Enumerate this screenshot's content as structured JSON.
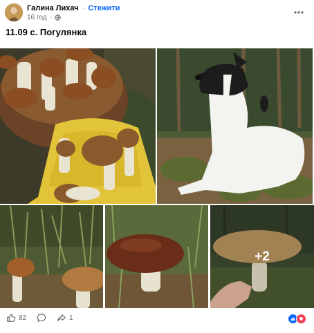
{
  "post": {
    "author": "Галина Лихач",
    "separator": "·",
    "follow_label": "Стежити",
    "time": "16 год",
    "text": "11.09 с. Погулянка"
  },
  "photos": {
    "overflow_label": "+2",
    "items": [
      {
        "name": "mushroom-basket-photo"
      },
      {
        "name": "dog-photo"
      },
      {
        "name": "mushrooms-in-grass-photo"
      },
      {
        "name": "large-mushroom-photo"
      },
      {
        "name": "hand-holding-mushroom-photo"
      }
    ]
  },
  "actions": {
    "like_count": "82",
    "share_count": "1"
  },
  "icons": {
    "globe": "globe-icon",
    "more": "more-options-icon",
    "like": "like-icon",
    "comment": "comment-icon",
    "share": "share-icon",
    "reaction_like": "reaction-like-icon",
    "reaction_love": "reaction-love-icon"
  },
  "colors": {
    "link": "#0866ff",
    "meta": "#65676b",
    "reaction_like": "#0866ff",
    "reaction_love": "#f33e58"
  }
}
